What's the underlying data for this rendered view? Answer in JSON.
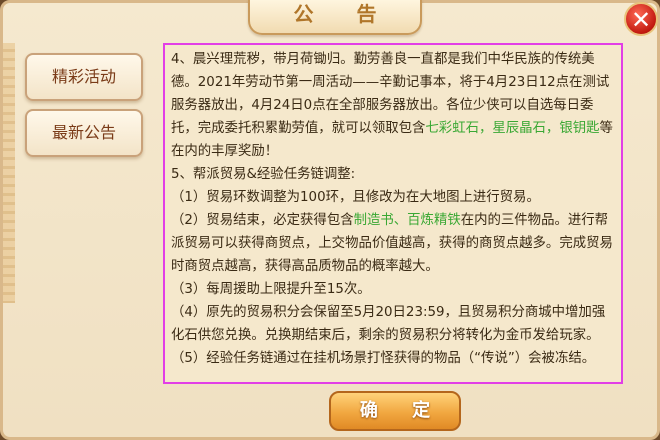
{
  "dialog": {
    "title": "公 告",
    "close_label": "✕",
    "confirm_label": "确 定"
  },
  "tabs": [
    {
      "label": "精彩活动"
    },
    {
      "label": "最新公告"
    }
  ],
  "content": {
    "p4_a": "4、晨兴理荒秽，带月荷锄归。勤劳善良一直都是我们中华民族的传统美德。2021年劳动节第一周活动——辛勤记事本，将于4月23日12点在测试服务器放出，4月24日0点在全部服务器放出。各位少侠可以自选每日委托，完成委托积累勤劳值，就可以领取包含",
    "p4_green": "七彩虹石，星辰晶石，银钥匙",
    "p4_b": "等在内的丰厚奖励！",
    "p5": "5、帮派贸易&经验任务链调整:",
    "p5_1": "（1）贸易环数调整为100环，且修改为在大地图上进行贸易。",
    "p5_2_a": "（2）贸易结束，必定获得包含",
    "p5_2_green": "制造书、百炼精铁",
    "p5_2_b": "在内的三件物品。进行帮派贸易可以获得商贸点，上交物品价值越高，获得的商贸点越多。完成贸易时商贸点越高，获得高品质物品的概率越大。",
    "p5_3": "（3）每周援助上限提升至15次。",
    "p5_4": "（4）原先的贸易积分会保留至5月20日23:59，且贸易积分商城中增加强化石供您兑换。兑换期结束后，剩余的贸易积分将转化为金币发给玩家。",
    "p5_5": "（5）经验任务链通过在挂机场景打怪获得的物品（“传说”）会被冻结。"
  }
}
